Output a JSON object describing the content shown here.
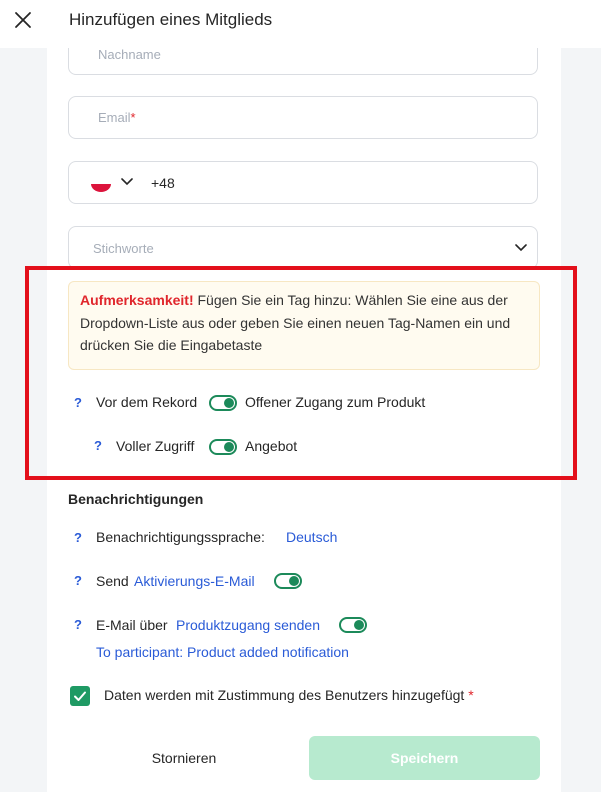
{
  "header": {
    "title": "Hinzufügen eines Mitglieds",
    "close_icon": "close-icon"
  },
  "form": {
    "lastname_placeholder": "Nachname",
    "email_placeholder": "Email",
    "email_required_mark": "*",
    "phone": {
      "flag_icon": "poland-flag-icon",
      "code": "+48"
    },
    "tags_placeholder": "Stichworte"
  },
  "alert": {
    "strong": "Aufmerksamkeit!",
    "text": " Fügen Sie ein Tag hinzu: Wählen Sie eine aus der Dropdown-Liste aus oder geben Sie einen neuen Tag-Namen ein und drücken Sie die Eingabetaste"
  },
  "access": {
    "help_mark": "?",
    "before_record_label": "Vor dem Rekord",
    "open_access_label": "Offener Zugang zum Produkt",
    "full_access_label": "Voller Zugriff",
    "offer_label": "Angebot"
  },
  "notifications": {
    "title": "Benachrichtigungen",
    "language_label": "Benachrichtigungssprache:",
    "language_value": "Deutsch",
    "send_label": "Send",
    "activation_link": "Aktivierungs-E-Mail",
    "email_about_label": "E-Mail über",
    "product_access_link": "Produktzugang senden",
    "participant_link": "To participant: Product added notification"
  },
  "consent": {
    "label": "Daten werden mit Zustimmung des Benutzers hinzugefügt",
    "required_mark": "*",
    "checked": true
  },
  "buttons": {
    "cancel": "Stornieren",
    "save": "Speichern"
  },
  "colors": {
    "accent_green": "#1f9a64",
    "link_blue": "#2a5bd7",
    "alert_red": "#e3101b",
    "save_disabled": "#b7eacf"
  }
}
